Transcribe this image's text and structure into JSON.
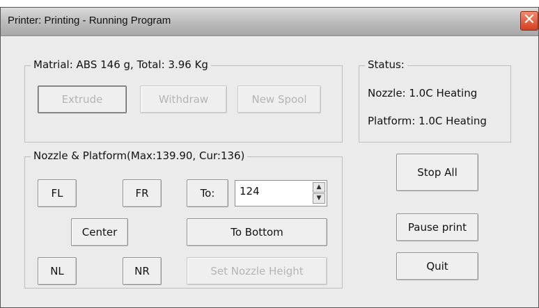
{
  "window": {
    "title": "Printer: Printing - Running Program",
    "close_glyph": "✕"
  },
  "material_group": {
    "legend": "Matrial: ABS 146 g,  Total: 3.96 Kg",
    "buttons": {
      "extrude": "Extrude",
      "withdraw": "Withdraw",
      "new_spool": "New Spool"
    }
  },
  "status_group": {
    "legend": "Status:",
    "nozzle": "Nozzle: 1.0C Heating",
    "platform": "Platform: 1.0C Heating"
  },
  "nozzle_group": {
    "legend": "Nozzle & Platform(Max:139.90, Cur:136)",
    "buttons": {
      "fl": "FL",
      "fr": "FR",
      "to": "To:",
      "center": "Center",
      "to_bottom": "To Bottom",
      "nl": "NL",
      "nr": "NR",
      "set_nozzle_height": "Set Nozzle Height"
    },
    "to_value": "124",
    "spin_up_icon": "▲",
    "spin_down_icon": "▼"
  },
  "actions": {
    "stop_all": "Stop All",
    "pause_print": "Pause print",
    "quit": "Quit"
  }
}
